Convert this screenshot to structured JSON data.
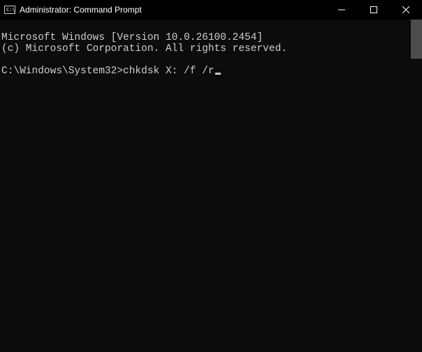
{
  "window": {
    "title": "Administrator: Command Prompt"
  },
  "terminal": {
    "line1": "Microsoft Windows [Version 10.0.26100.2454]",
    "line2": "(c) Microsoft Corporation. All rights reserved.",
    "blank": "",
    "prompt": "C:\\Windows\\System32>",
    "command": "chkdsk X: /f /r"
  }
}
